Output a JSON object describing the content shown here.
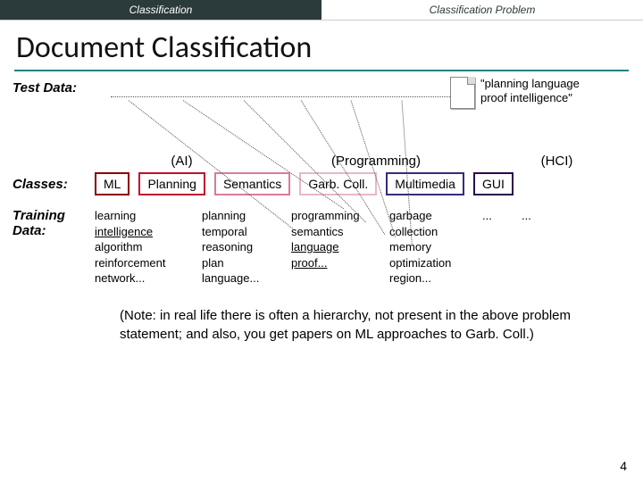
{
  "topbar": {
    "left": "Classification",
    "right": "Classification Problem"
  },
  "title": "Document Classification",
  "labels": {
    "test": "Test Data:",
    "classes": "Classes:",
    "training": "Training Data:"
  },
  "document_snippet": "\"planning language proof intelligence\"",
  "supercategories": {
    "ai": "(AI)",
    "prog": "(Programming)",
    "hci": "(HCI)"
  },
  "classes": {
    "ml": "ML",
    "planning": "Planning",
    "semantics": "Semantics",
    "garb": "Garb. Coll.",
    "multimedia": "Multimedia",
    "gui": "GUI"
  },
  "training": {
    "ml": [
      "learning",
      "intelligence",
      "algorithm",
      "reinforcement",
      "network..."
    ],
    "planning": [
      "planning",
      "temporal",
      "reasoning",
      "plan",
      "language..."
    ],
    "semantics": [
      "programming",
      "semantics",
      "language",
      "proof..."
    ],
    "garb": [
      "garbage",
      "collection",
      "memory",
      "optimization",
      "region..."
    ],
    "multimedia": [
      "..."
    ],
    "gui": [
      "..."
    ]
  },
  "note": "(Note: in real life there is often a hierarchy, not present in the above problem statement; and also, you get papers on ML approaches to Garb. Coll.)",
  "page_number": "4"
}
